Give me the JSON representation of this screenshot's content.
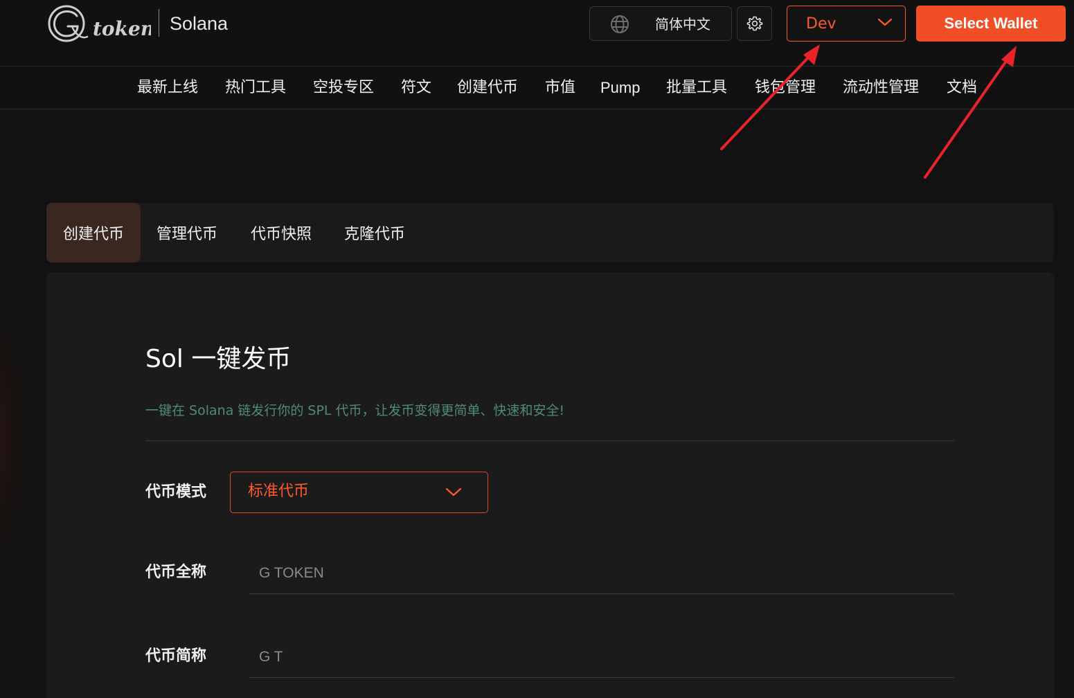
{
  "header": {
    "logo_text": "token",
    "chain_name": "Solana",
    "language_label": "简体中文",
    "network_selected": "Dev",
    "wallet_button": "Select Wallet"
  },
  "nav": {
    "items": [
      "最新上线",
      "热门工具",
      "空投专区",
      "符文",
      "创建代币",
      "市值",
      "Pump",
      "批量工具",
      "钱包管理",
      "流动性管理",
      "文档"
    ]
  },
  "tabs": {
    "items": [
      "创建代币",
      "管理代币",
      "代币快照",
      "克隆代币"
    ],
    "active_index": 0
  },
  "form": {
    "title": "Sol 一键发币",
    "subtitle": "一键在 Solana 链发行你的 SPL 代币，让发币变得更简单、快速和安全!",
    "mode_label": "代币模式",
    "mode_value": "标准代币",
    "name_label": "代币全称",
    "name_placeholder": "G TOKEN",
    "symbol_label": "代币简称",
    "symbol_placeholder": "G T"
  },
  "colors": {
    "accent": "#f24e25",
    "subtitle": "#4f8a7d",
    "annotation_arrow": "#e8232a"
  },
  "icons": {
    "globe": "globe-icon",
    "settings": "gear-icon",
    "dropdown": "chevron-down-icon"
  }
}
